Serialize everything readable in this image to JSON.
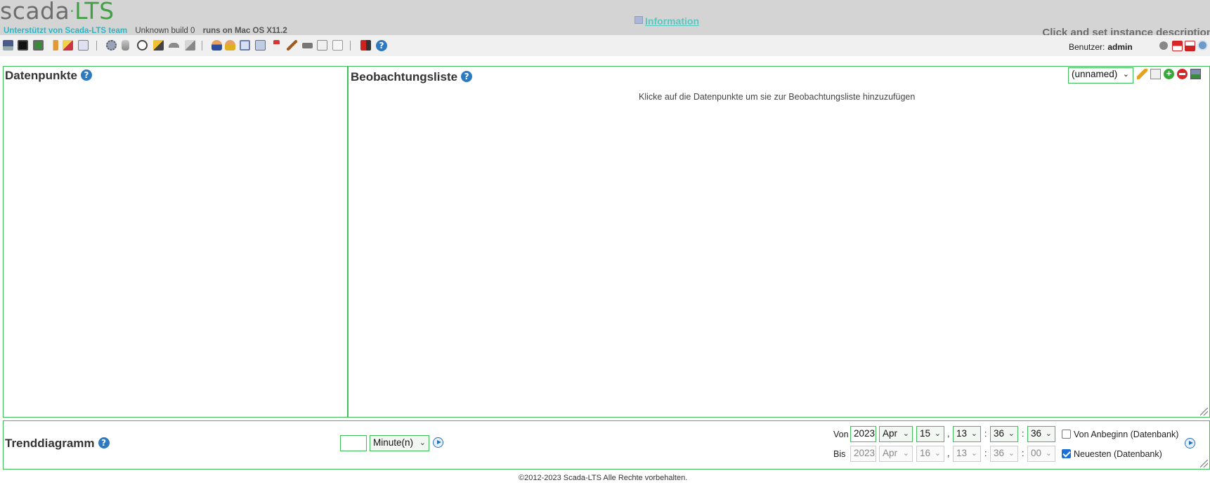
{
  "header": {
    "logo_main": "SCADA",
    "logo_dot": "·",
    "logo_suffix": "LTS",
    "support": "Unterstützt von Scada-LTS team",
    "build": "Unknown build 0",
    "os": "runs on Mac OS X11.2",
    "info_link": "Information",
    "instance_description": "Click and set instance description"
  },
  "toolbar": {
    "icons": [
      "graphic-views-icon",
      "watch-list-icon",
      "point-details-icon",
      "event-detection-icon",
      "alarms-icon",
      "reports-icon",
      "data-sources-icon",
      "database-icon",
      "scheduled-events-icon",
      "compound-events-icon",
      "point-links-icon",
      "scripting-icon",
      "users-icon",
      "user-profiles-icon",
      "point-hierarchy-icon",
      "mailing-lists-icon",
      "publishers-icon",
      "maintenance-events-icon",
      "system-settings-icon",
      "emport-icon",
      "sql-icon",
      "logout-icon",
      "help-icon"
    ],
    "user_label": "Benutzer:",
    "username": "admin",
    "right_icons": [
      "undo-icon",
      "home-icon",
      "home-set-icon",
      "language-icon"
    ]
  },
  "datapoints": {
    "title": "Datenpunkte"
  },
  "watchlist": {
    "title": "Beobachtungsliste",
    "selected": "(unnamed)",
    "hint": "Klicke auf die Datenpunkte um sie zur Beobachtungsliste hinzuzufügen"
  },
  "trend": {
    "title": "Trenddiagramm",
    "period_value": "",
    "period_unit": "Minute(n)",
    "from_label": "Von",
    "to_label": "Bis",
    "from": {
      "year": "2023",
      "month": "Apr",
      "day": "15",
      "hour": "13",
      "minute": "36",
      "second": "36"
    },
    "to": {
      "year": "2023",
      "month": "Apr",
      "day": "16",
      "hour": "13",
      "minute": "36",
      "second": "00"
    },
    "from_beginning_label": "Von Anbeginn (Datenbank)",
    "from_beginning_checked": false,
    "latest_label": "Neuesten (Datenbank)",
    "latest_checked": true
  },
  "footer": {
    "copyright": "©2012-2023 Scada-LTS Alle Rechte vorbehalten."
  }
}
